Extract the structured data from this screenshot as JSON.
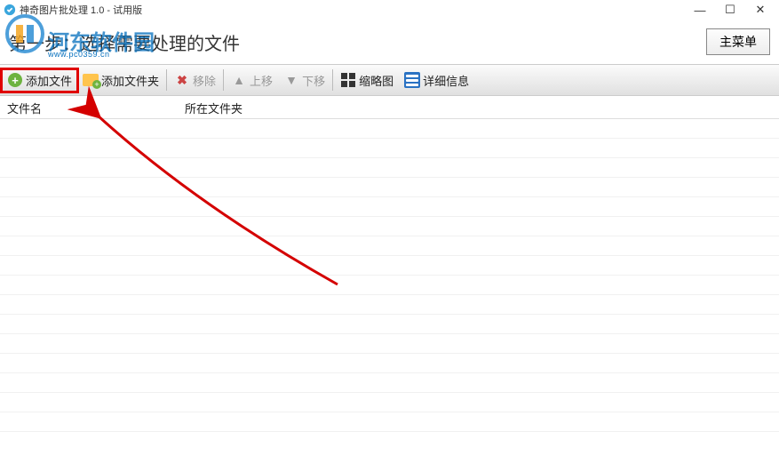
{
  "titlebar": {
    "title": "神奇图片批处理 1.0 - 试用版"
  },
  "watermark": {
    "text": "河东软件园",
    "sub": "www.pc0359.cn"
  },
  "step": {
    "title": "第一步：选择需要处理的文件"
  },
  "main_menu": {
    "label": "主菜单"
  },
  "toolbar": {
    "add_file": "添加文件",
    "add_folder": "添加文件夹",
    "remove": "移除",
    "move_up": "上移",
    "move_down": "下移",
    "thumb": "缩略图",
    "detail": "详细信息"
  },
  "columns": {
    "name": "文件名",
    "folder": "所在文件夹"
  }
}
